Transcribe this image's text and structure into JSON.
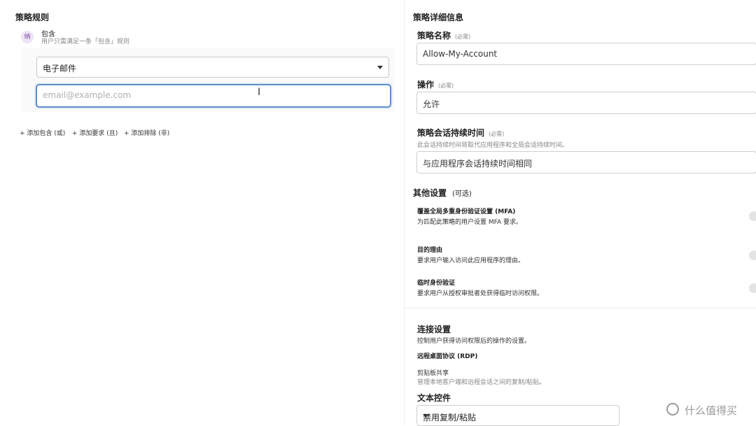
{
  "left": {
    "title": "策略规则",
    "include": {
      "badge": "纳",
      "label": "包含",
      "desc": "用户只需满足一条「包含」规则"
    },
    "selector": {
      "value": "电子邮件"
    },
    "email": {
      "placeholder": "email@example.com",
      "value": ""
    },
    "add_links": [
      "+ 添加包含 (或)",
      "+ 添加要求 (且)",
      "+ 添加排除 (非)"
    ]
  },
  "right": {
    "title": "策略详细信息",
    "policy_name": {
      "label": "策略名称",
      "required": "(必需)",
      "value": "Allow-My-Account"
    },
    "action": {
      "label": "操作",
      "required": "(必需)",
      "value": "允许"
    },
    "session": {
      "label": "策略会话持续时间",
      "required": "(必需)",
      "desc": "此会话持续时间将取代应用程序和全局会话持续时间。",
      "value": "与应用程序会话持续时间相同"
    },
    "other": {
      "title": "其他设置",
      "optional": "(可选)",
      "items": [
        {
          "title": "覆盖全局多重身份验证设置 (MFA)",
          "desc": "为匹配此策略的用户设置 MFA 要求。"
        },
        {
          "title": "目的理由",
          "desc": "要求用户输入访问此应用程序的理由。"
        },
        {
          "title": "临时身份验证",
          "desc": "要求用户从授权审批者处获得临时访问权限。"
        }
      ]
    },
    "connection": {
      "title": "连接设置",
      "desc": "控制用户获得访问权限后的操作的设置。",
      "rdp": "远程桌面协议 (RDP)",
      "clipboard_title": "剪贴板共享",
      "clipboard_desc": "管理本地客户端和远程会话之间的复制/粘贴。",
      "text_control": "文本控件",
      "text_control_value": "禁用复制/粘贴"
    }
  },
  "watermark": {
    "text": "什么值得买"
  }
}
